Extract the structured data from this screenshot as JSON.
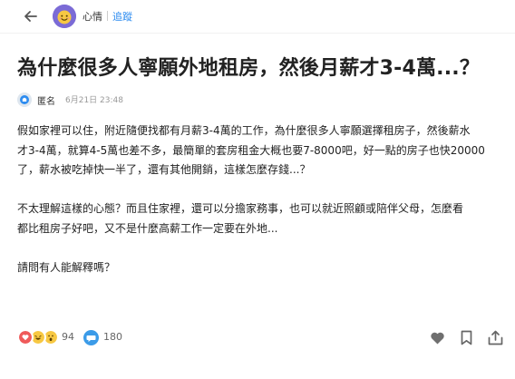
{
  "header": {
    "forum_name": "心情",
    "follow_label": "追蹤"
  },
  "post": {
    "title": "為什麼很多人寧願外地租房，然後月薪才3-4萬...？",
    "author": "匿名",
    "time": "6月21日 23:48",
    "paragraphs": [
      "假如家裡可以住，附近隨便找都有月薪3-4萬的工作，為什麼很多人寧願選擇租房子，然後薪水\n才3-4萬，就算4-5萬也差不多，最簡單的套房租金大概也要7-8000吧，好一點的房子也快20000\n了，薪水被吃掉快一半了，還有其他開銷，這樣怎麼存錢...？",
      "不太理解這樣的心態？而且住家裡，還可以分擔家務事，也可以就近照顧或陪伴父母，怎麼看\n都比租房子好吧，又不是什麼高薪工作一定要在外地...",
      "請問有人能解釋嗎？"
    ]
  },
  "actions": {
    "reaction_count": "94",
    "comment_count": "180"
  },
  "icons": {
    "back": "arrow-left-icon",
    "reactions": [
      "heart-reaction-icon",
      "laugh-reaction-icon",
      "wow-reaction-icon"
    ],
    "comment": "comment-bubble-icon",
    "like": "heart-outline-icon",
    "bookmark": "bookmark-icon",
    "share": "share-icon"
  },
  "colors": {
    "accent": "#2d8cf0",
    "heart_reaction": "#ef5a5a",
    "emoji_yellow": "#f7c843"
  }
}
